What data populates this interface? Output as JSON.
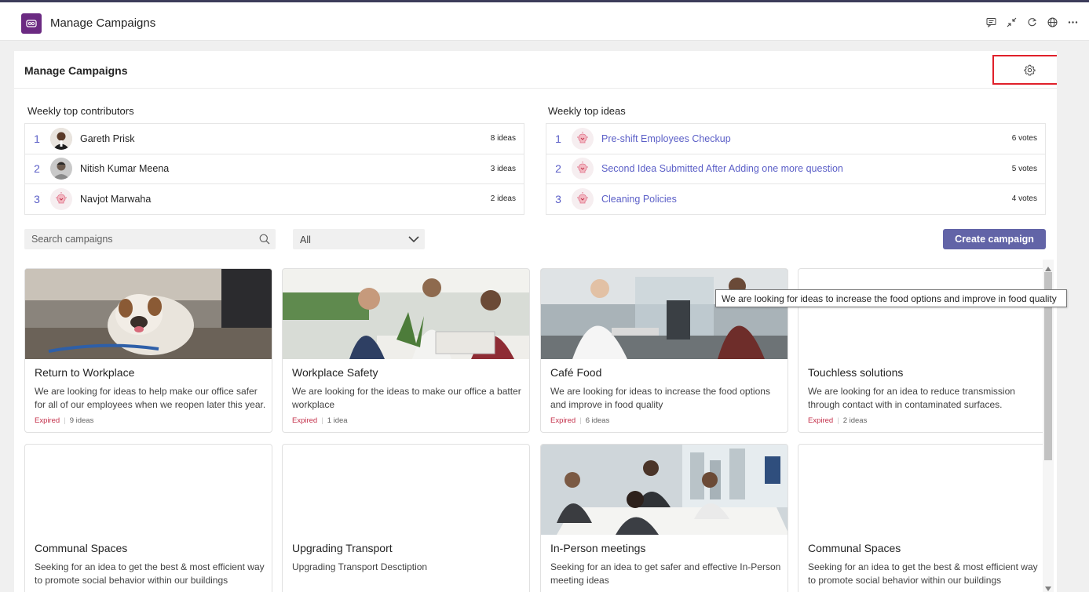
{
  "app": {
    "title": "Manage Campaigns"
  },
  "panel": {
    "title": "Manage Campaigns"
  },
  "contributors": {
    "label": "Weekly top contributors",
    "items": [
      {
        "rank": "1",
        "name": "Gareth Prisk",
        "count": "8 ideas"
      },
      {
        "rank": "2",
        "name": "Nitish Kumar Meena",
        "count": "3 ideas"
      },
      {
        "rank": "3",
        "name": "Navjot Marwaha",
        "count": "2 ideas"
      }
    ]
  },
  "top_ideas": {
    "label": "Weekly top ideas",
    "items": [
      {
        "rank": "1",
        "title": "Pre-shift Employees Checkup",
        "votes": "6 votes"
      },
      {
        "rank": "2",
        "title": "Second Idea Submitted After Adding one more question",
        "votes": "5 votes"
      },
      {
        "rank": "3",
        "title": "Cleaning Policies",
        "votes": "4 votes"
      }
    ]
  },
  "search": {
    "placeholder": "Search campaigns"
  },
  "filter": {
    "value": "All"
  },
  "create_button": "Create campaign",
  "tooltip": "We are looking for ideas to increase the food options and improve in food quality",
  "campaigns": [
    {
      "title": "Return to Workplace",
      "description": "We are looking for ideas to help make our office safer for all of our employees when we reopen later this year.",
      "status": "Expired",
      "ideas": "9 ideas"
    },
    {
      "title": "Workplace Safety",
      "description": "We are looking for the ideas to make our office a batter workplace",
      "status": "Expired",
      "ideas": "1 idea"
    },
    {
      "title": "Café Food",
      "description": "We are looking for ideas to increase the food options and improve in food quality",
      "status": "Expired",
      "ideas": "6 ideas"
    },
    {
      "title": "Touchless solutions",
      "description": "We are looking for an idea to reduce transmission through contact with in contaminated surfaces.",
      "status": "Expired",
      "ideas": "2 ideas"
    },
    {
      "title": "Communal Spaces",
      "description": "Seeking for an idea to get the best & most efficient way to promote social behavior within our buildings"
    },
    {
      "title": "Upgrading Transport",
      "description": "Upgrading Transport  Desctiption"
    },
    {
      "title": "In-Person meetings",
      "description": "Seeking for an idea to get safer and effective In-Person meeting ideas"
    },
    {
      "title": "Communal Spaces",
      "description": "Seeking for an idea to get the best & most efficient way to promote social behavior within our buildings"
    }
  ],
  "colors": {
    "accent": "#6264a7",
    "link": "#5b5fc7",
    "expired": "#c4314b",
    "highlight": "#e0202a",
    "logo": "#6b2a82"
  },
  "icons": [
    "app-logo-icon",
    "chat-icon",
    "collapse-icon",
    "refresh-icon",
    "globe-icon",
    "more-icon",
    "gear-icon",
    "search-icon",
    "chevron-down-icon",
    "idea-bulb-icon"
  ]
}
